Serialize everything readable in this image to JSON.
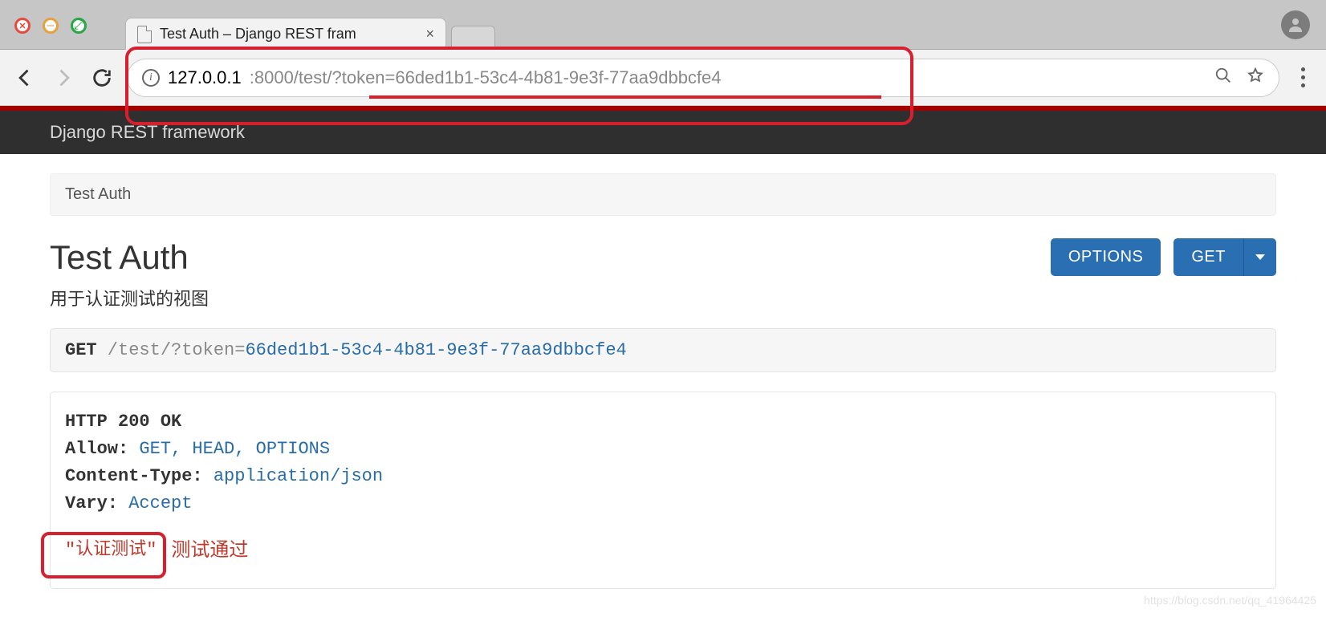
{
  "browser": {
    "tab_title": "Test Auth – Django REST fram",
    "url_host": "127.0.0.1",
    "url_path": ":8000/test/?token=66ded1b1-53c4-4b81-9e3f-77aa9dbbcfe4"
  },
  "nav": {
    "brand": "Django REST framework"
  },
  "breadcrumb": "Test Auth",
  "page": {
    "title": "Test Auth",
    "description": "用于认证测试的视图"
  },
  "buttons": {
    "options": "OPTIONS",
    "get": "GET"
  },
  "request": {
    "method": "GET",
    "path_prefix": " /test/?",
    "token_key": "token",
    "eq": "=",
    "token_value": "66ded1b1-53c4-4b81-9e3f-77aa9dbbcfe4"
  },
  "response": {
    "status_line": "HTTP 200 OK",
    "headers": [
      {
        "k": "Allow:",
        "v": " GET, HEAD, OPTIONS"
      },
      {
        "k": "Content-Type:",
        "v": " application/json"
      },
      {
        "k": "Vary:",
        "v": " Accept"
      }
    ],
    "body_text": "\"认证测试\"",
    "annotation": "测试通过"
  },
  "watermark": "https://blog.csdn.net/qq_41964425"
}
